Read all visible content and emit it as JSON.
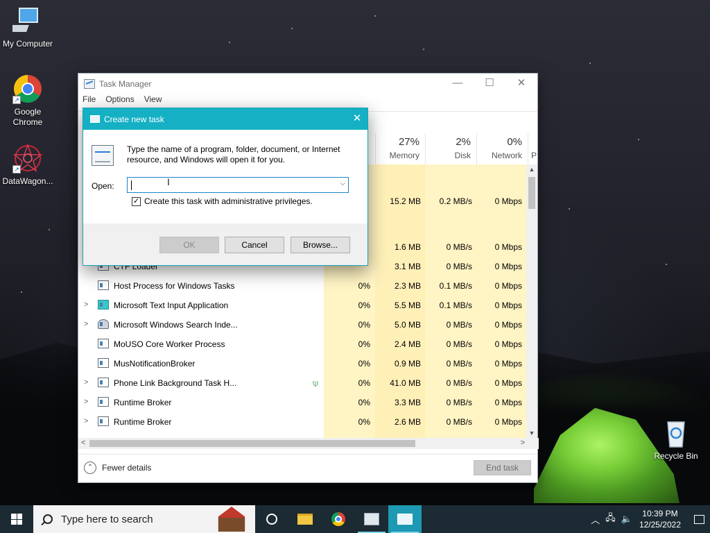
{
  "desktop": {
    "icons": [
      {
        "label": "My Computer"
      },
      {
        "label": "Google Chrome"
      },
      {
        "label": "DataWagon..."
      },
      {
        "label": "Recycle Bin"
      }
    ]
  },
  "task_manager": {
    "title": "Task Manager",
    "menu": [
      "File",
      "Options",
      "View"
    ],
    "columns": {
      "cpu": {
        "pct": "",
        "name": ""
      },
      "memory": {
        "pct": "27%",
        "name": "Memory"
      },
      "disk": {
        "pct": "2%",
        "name": "Disk"
      },
      "network": {
        "pct": "0%",
        "name": "Network"
      },
      "power": {
        "name": "P"
      }
    },
    "rows": [
      {
        "name": "",
        "cpu": "",
        "memory": "15.2 MB",
        "disk": "0.2 MB/s",
        "network": "0 Mbps",
        "expand": false
      },
      {
        "name": "",
        "cpu": "",
        "memory": "1.6 MB",
        "disk": "0 MB/s",
        "network": "0 Mbps",
        "expand": false
      },
      {
        "name": "CTF Loader",
        "cpu": "",
        "memory": "3.1 MB",
        "disk": "0 MB/s",
        "network": "0 Mbps",
        "expand": false
      },
      {
        "name": "Host Process for Windows Tasks",
        "cpu": "0%",
        "memory": "2.3 MB",
        "disk": "0.1 MB/s",
        "network": "0 Mbps",
        "expand": false
      },
      {
        "name": "Microsoft Text Input Application",
        "cpu": "0%",
        "memory": "5.5 MB",
        "disk": "0.1 MB/s",
        "network": "0 Mbps",
        "expand": true
      },
      {
        "name": "Microsoft Windows Search Inde...",
        "cpu": "0%",
        "memory": "5.0 MB",
        "disk": "0 MB/s",
        "network": "0 Mbps",
        "expand": true
      },
      {
        "name": "MoUSO Core Worker Process",
        "cpu": "0%",
        "memory": "2.4 MB",
        "disk": "0 MB/s",
        "network": "0 Mbps",
        "expand": false
      },
      {
        "name": "MusNotificationBroker",
        "cpu": "0%",
        "memory": "0.9 MB",
        "disk": "0 MB/s",
        "network": "0 Mbps",
        "expand": false
      },
      {
        "name": "Phone Link Background Task H...",
        "cpu": "0%",
        "memory": "41.0 MB",
        "disk": "0 MB/s",
        "network": "0 Mbps",
        "expand": true
      },
      {
        "name": "Runtime Broker",
        "cpu": "0%",
        "memory": "3.3 MB",
        "disk": "0 MB/s",
        "network": "0 Mbps",
        "expand": true
      },
      {
        "name": "Runtime Broker",
        "cpu": "0%",
        "memory": "2.6 MB",
        "disk": "0 MB/s",
        "network": "0 Mbps",
        "expand": true
      }
    ],
    "fewer_details": "Fewer details",
    "end_task": "End task"
  },
  "run_dialog": {
    "title": "Create new task",
    "description": "Type the name of a program, folder, document, or Internet resource, and Windows will open it for you.",
    "open_label": "Open:",
    "open_value": "",
    "admin_checkbox": {
      "label": "Create this task with administrative privileges.",
      "checked": true
    },
    "buttons": {
      "ok": "OK",
      "cancel": "Cancel",
      "browse": "Browse..."
    }
  },
  "taskbar": {
    "search_placeholder": "Type here to search",
    "time": "10:39 PM",
    "date": "12/25/2022"
  }
}
